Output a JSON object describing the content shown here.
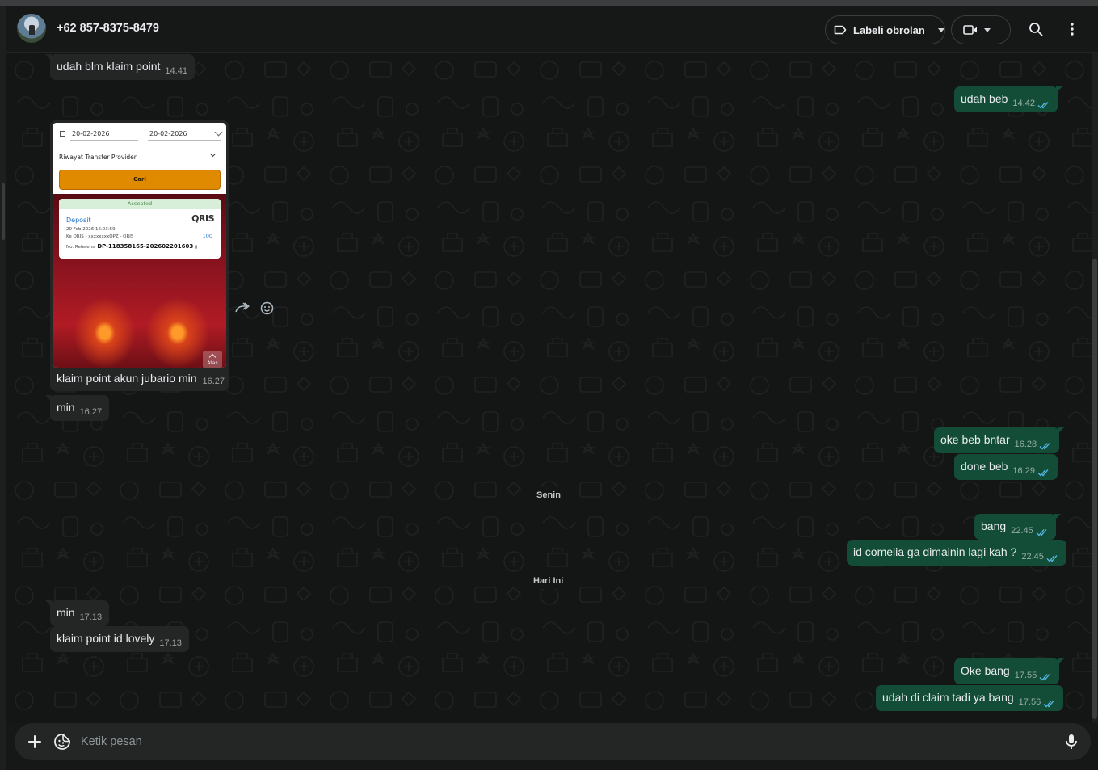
{
  "header": {
    "contact_name": "+62 857-8375-8479",
    "label_button": "Labeli obrolan",
    "icons": [
      "avatar",
      "label-icon",
      "video-call-icon",
      "search-icon",
      "menu-dots-icon"
    ]
  },
  "messages_in": [
    {
      "text": "udah blm klaim point",
      "time": "14.41"
    },
    {
      "text": "min",
      "time": "16.27"
    },
    {
      "text": "min",
      "time": "17.13"
    },
    {
      "text": "klaim point id lovely",
      "time": "17.13"
    }
  ],
  "image_message": {
    "date_from": "20-02-2026",
    "date_to": "20-02-2026",
    "filter_label": "Riwayat Transfer Provider",
    "search_button": "Cari",
    "status": "Accepted",
    "type": "Deposit",
    "qris_logo": "QRIS",
    "datetime": "20 Feb 2026 16:03:59",
    "destination": "Ke QRIS - xxxxxxxxOPZ - QRIS",
    "amount": "100",
    "reference_label": "No. Referensi",
    "reference": "DP-118358165-202602201603",
    "scroll_top": "Atas",
    "caption": "klaim point akun jubario min",
    "time": "16.27"
  },
  "messages_out": [
    {
      "text": "udah beb",
      "time": "14.42"
    },
    {
      "text": "oke beb bntar",
      "time": "16.28"
    },
    {
      "text": "done beb",
      "time": "16.29"
    },
    {
      "text": "bang",
      "time": "22.45"
    },
    {
      "text": "id comelia ga dimainin lagi kah ?",
      "time": "22.45"
    },
    {
      "text": "Oke bang",
      "time": "17.55"
    },
    {
      "text": "udah di claim tadi ya bang",
      "time": "17.56"
    }
  ],
  "date_separators": [
    "Senin",
    "Hari Ini"
  ],
  "composer": {
    "placeholder": "Ketik pesan",
    "icons": [
      "plus-icon",
      "sticker-icon",
      "mic-icon"
    ]
  },
  "colors": {
    "incoming_bubble": "#242626",
    "outgoing_bubble": "#144d37",
    "read_ticks": "#53bdeb",
    "background": "#141515"
  }
}
